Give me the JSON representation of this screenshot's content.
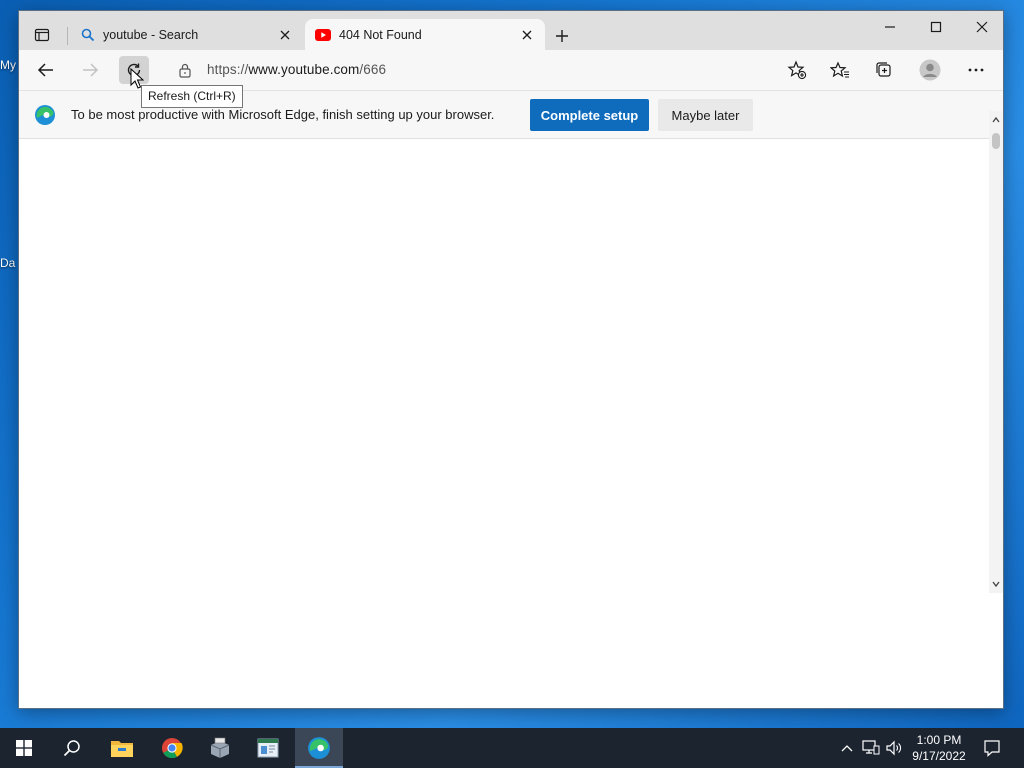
{
  "desktop": {
    "labels": [
      "My",
      "Da"
    ]
  },
  "tabs": [
    {
      "title": "youtube - Search",
      "icon": "search-icon",
      "active": false
    },
    {
      "title": "404 Not Found",
      "icon": "youtube-icon",
      "active": true
    }
  ],
  "toolbar": {
    "url_scheme": "https://",
    "url_host": "www.youtube.com",
    "url_path": "/666",
    "refresh_tooltip": "Refresh (Ctrl+R)"
  },
  "infobar": {
    "message": "To be most productive with Microsoft Edge, finish setting up your browser.",
    "primary_label": "Complete setup",
    "secondary_label": "Maybe later"
  },
  "taskbar": {
    "time": "1:00 PM",
    "date": "9/17/2022"
  },
  "colors": {
    "accent": "#0f6cbd",
    "taskbar": "#1c2430",
    "youtube_red": "#ff0000"
  }
}
